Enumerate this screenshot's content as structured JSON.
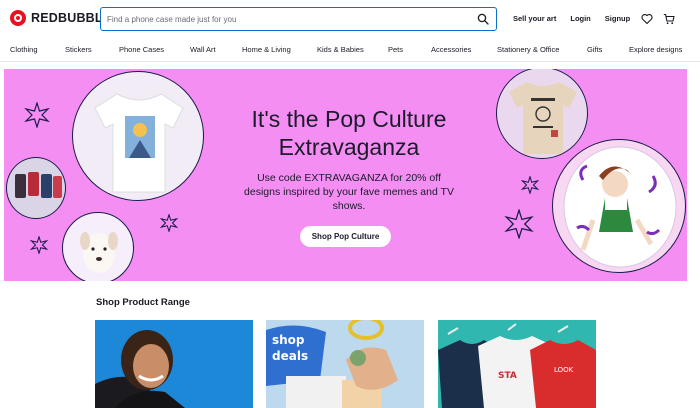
{
  "header": {
    "logo_text": "REDBUBBLE",
    "search_placeholder": "Find a phone case made just for you",
    "links": [
      "Sell your art",
      "Login",
      "Signup"
    ]
  },
  "categories": [
    "Clothing",
    "Stickers",
    "Phone Cases",
    "Wall Art",
    "Home & Living",
    "Kids & Babies",
    "Pets",
    "Accessories",
    "Stationery & Office",
    "Gifts",
    "Explore designs"
  ],
  "hero": {
    "title": "It's the Pop Culture Extravaganza",
    "subtitle": "Use code EXTRAVAGANZA for 20% off designs inspired by your fave memes and TV shows.",
    "cta": "Shop Pop Culture",
    "background": "#f58ef3"
  },
  "section": {
    "title": "Shop Product Range"
  },
  "colors": {
    "brand": "#e41321",
    "search_border": "#0e6fc4",
    "outline": "#1b1b4a"
  }
}
